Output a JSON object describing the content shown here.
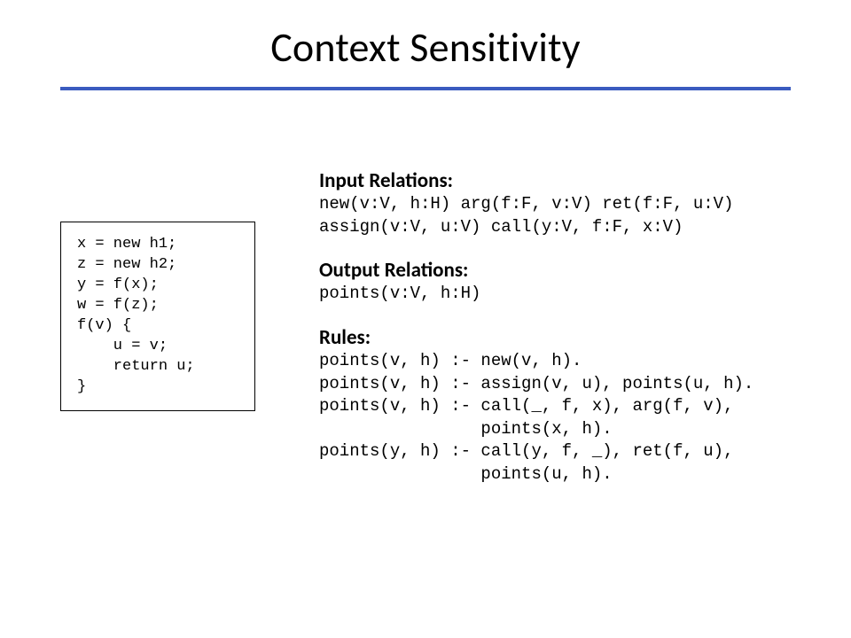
{
  "title": "Context Sensitivity",
  "code_box": "x = new h1;\nz = new h2;\ny = f(x);\nw = f(z);\nf(v) {\n    u = v;\n    return u;\n}",
  "sections": {
    "input_relations": {
      "heading": "Input Relations:",
      "body": "new(v:V, h:H) arg(f:F, v:V) ret(f:F, u:V)\nassign(v:V, u:V) call(y:V, f:F, x:V)"
    },
    "output_relations": {
      "heading": "Output Relations:",
      "body": "points(v:V, h:H)"
    },
    "rules": {
      "heading": "Rules:",
      "body": "points(v, h) :- new(v, h).\npoints(v, h) :- assign(v, u), points(u, h).\npoints(v, h) :- call(_, f, x), arg(f, v),\n                points(x, h).\npoints(y, h) :- call(y, f, _), ret(f, u),\n                points(u, h)."
    }
  }
}
